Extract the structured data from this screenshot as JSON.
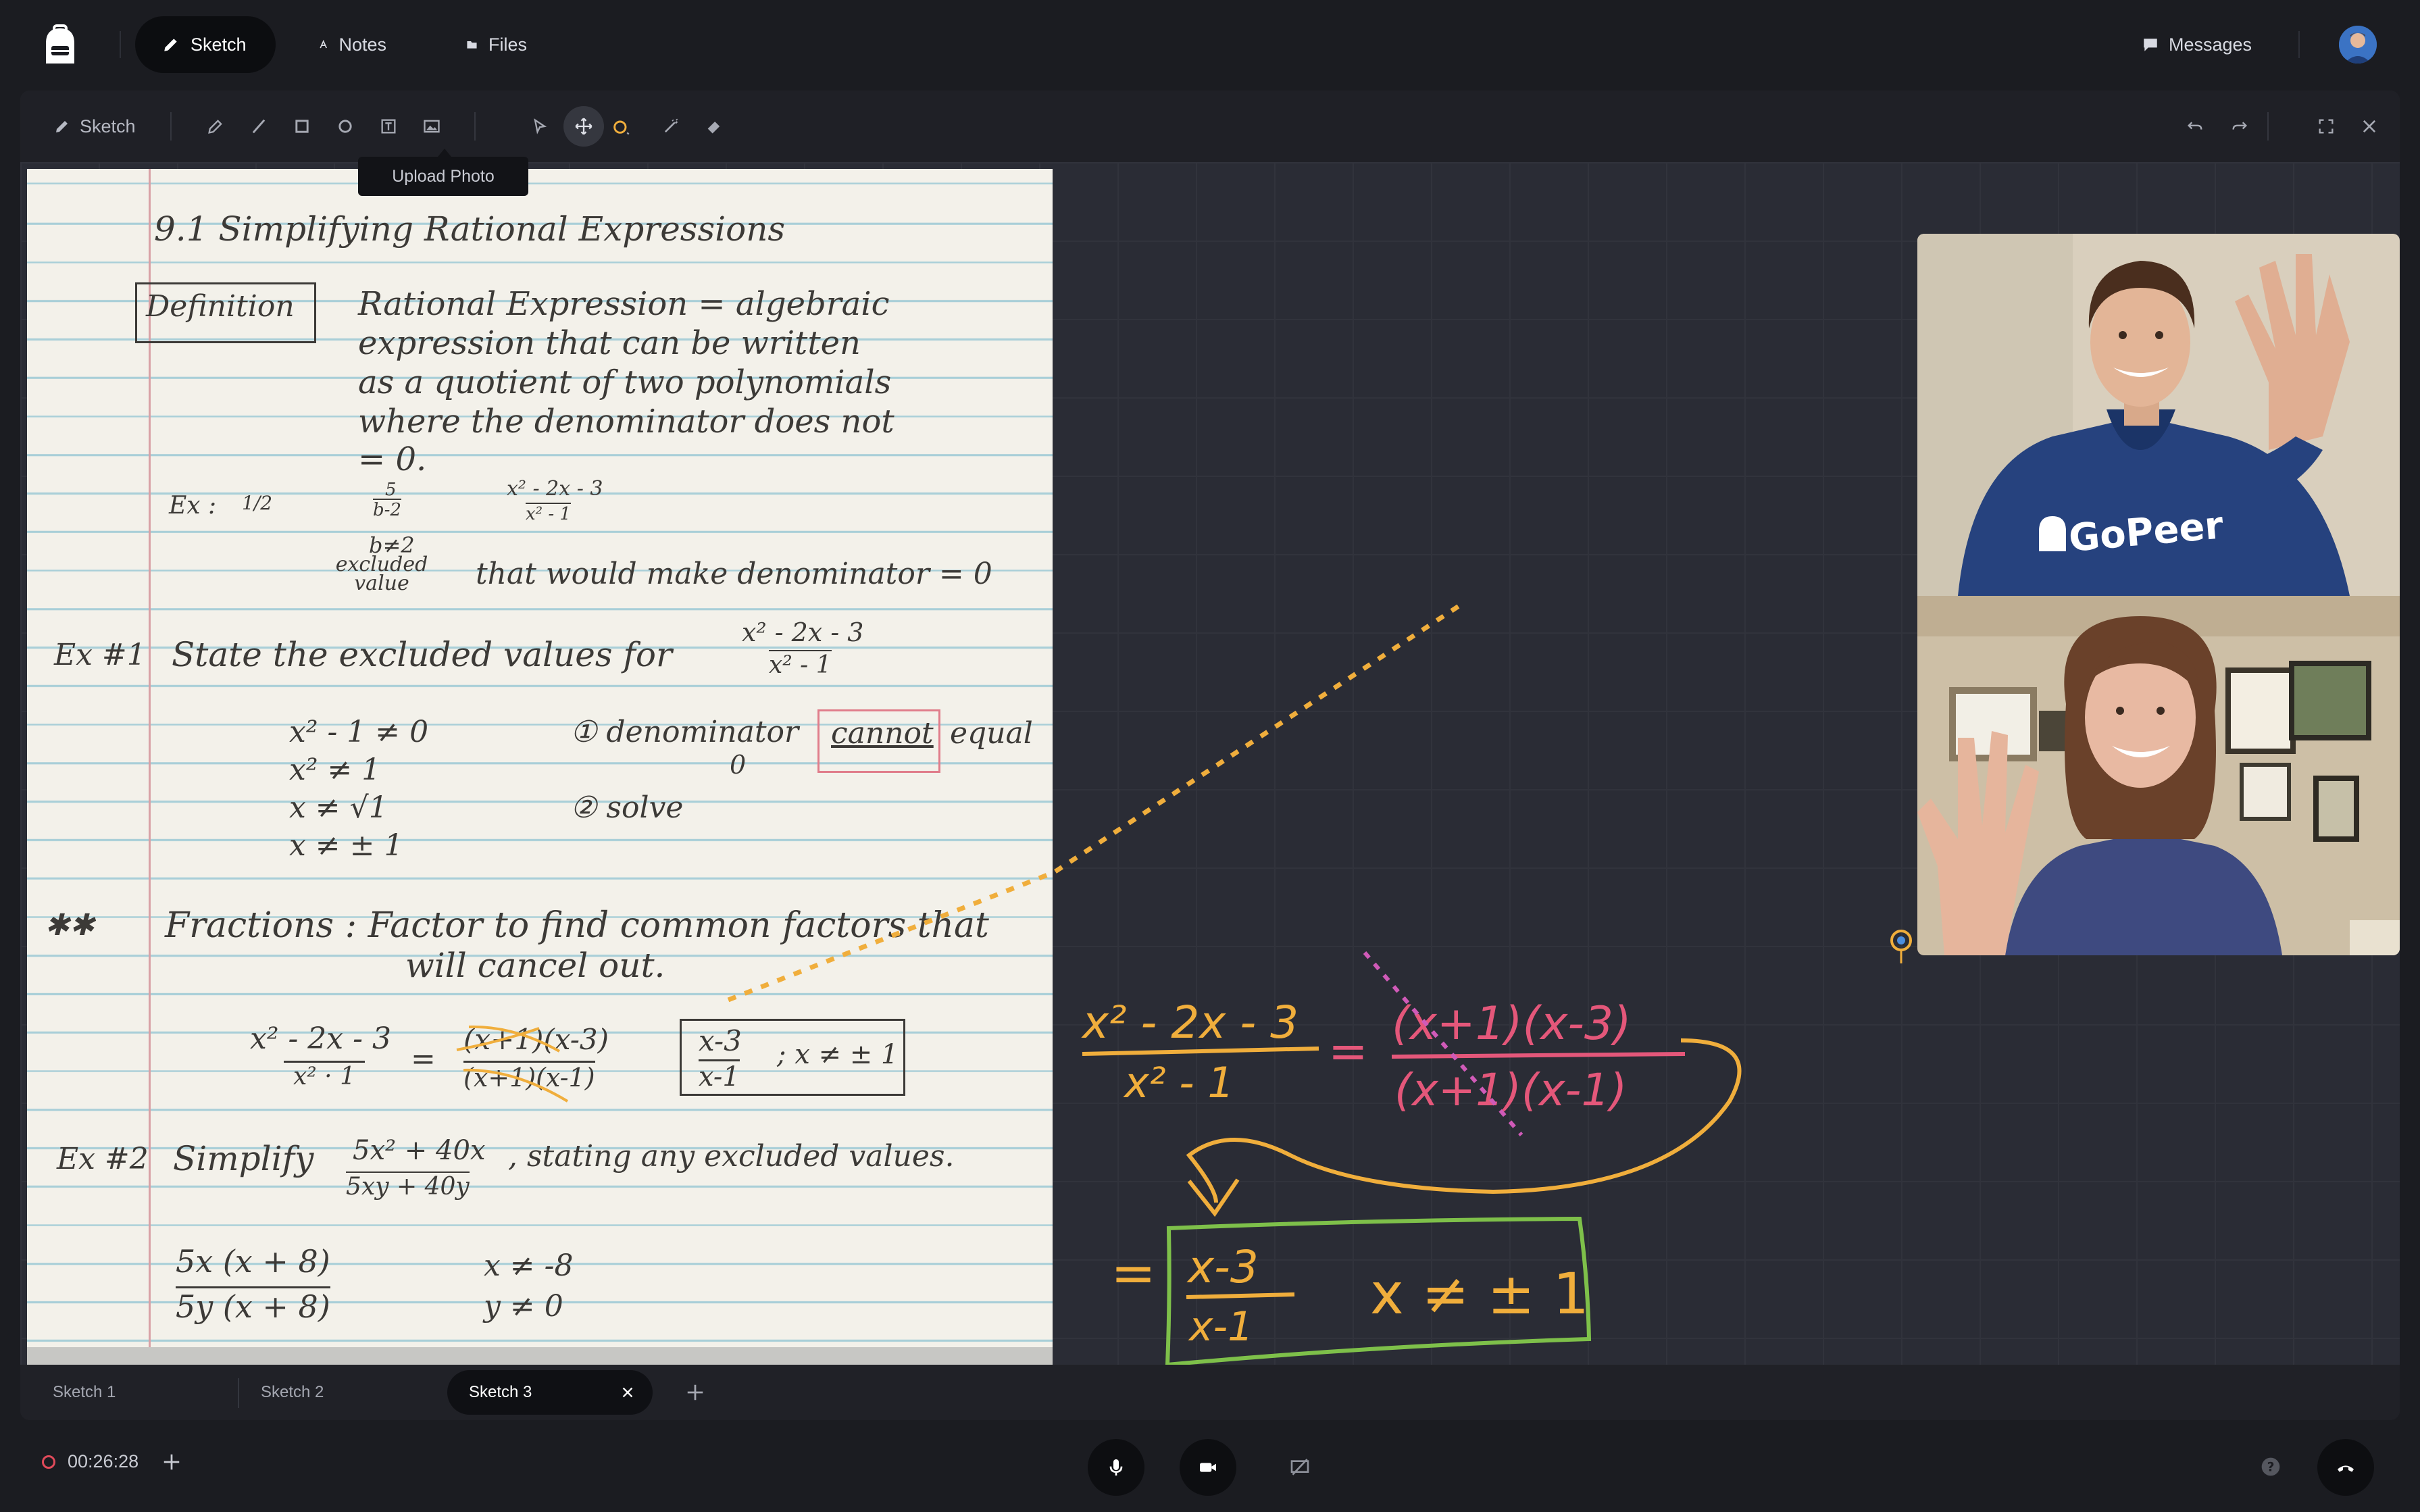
{
  "header": {
    "nav": [
      {
        "label": "Sketch",
        "icon": "pencil-icon",
        "active": true
      },
      {
        "label": "Notes",
        "icon": "notes-icon",
        "active": false
      },
      {
        "label": "Files",
        "icon": "folder-icon",
        "active": false
      }
    ],
    "messages_label": "Messages"
  },
  "toolbar": {
    "sketch_label": "Sketch",
    "tools": [
      "pen-icon",
      "line-icon",
      "rectangle-icon",
      "circle-icon",
      "text-icon",
      "image-icon",
      "select-icon",
      "move-icon",
      "color-icon",
      "wand-icon",
      "eraser-icon"
    ],
    "active_tool": "move-icon",
    "tooltip": "Upload Photo",
    "right": [
      "undo-icon",
      "redo-icon",
      "fullscreen-icon",
      "close-icon"
    ]
  },
  "notebook": {
    "title": "9.1 Simplifying Rational Expressions",
    "definition_label": "Definition",
    "definition_lines": [
      "Rational Expression = algebraic",
      "expression that can be written",
      "as a quotient of two polynomials",
      "where the denominator does not",
      "= 0."
    ],
    "ex_label": "Ex :",
    "ex_frac1": "1/2",
    "ex_frac2_num": "5",
    "ex_frac2_den": "b-2",
    "ex_frac3_num": "x² - 2x - 3",
    "ex_frac3_den": "x² - 1",
    "b_ne_2": "b≠2",
    "excluded_value": "excluded value",
    "that_note": "that would make denominator = 0",
    "ex1_label": "Ex #1",
    "ex1_text": "State the excluded values for",
    "ex1_num": "x² - 2x - 3",
    "ex1_den": "x² - 1",
    "steps_left": [
      "x² - 1 ≠ 0",
      "x² ≠ 1",
      "x ≠ √1",
      "x ≠ ± 1"
    ],
    "step1": "① denominator",
    "step1_cannot": "cannot",
    "step1_equal": "equal",
    "step1_zero": "0",
    "step2": "② solve",
    "stars": "✱✱",
    "fractions_line1": "Fractions : Factor to find common factors that",
    "fractions_line2": "will cancel out.",
    "eq_left_num": "x² - 2x - 3",
    "eq_left_den": "x² · 1",
    "eq_mid_num": "(x+1)(x-3)",
    "eq_mid_den": "(x+1)(x-1)",
    "eq_right_num": "x-3",
    "eq_right_den": "x-1",
    "eq_right_cond": "; x ≠ ± 1",
    "ex2_label": "Ex #2",
    "ex2_text": "Simplify",
    "ex2_num": "5x² + 40x",
    "ex2_den": "5xy + 40y",
    "ex2_tail": ", stating any excluded values.",
    "ex2_work_num": "5x (x + 8)",
    "ex2_work_den": "5y (x + 8)",
    "ex2_x": "x ≠ -8",
    "ex2_y": "y ≠ 0"
  },
  "videos": [
    {
      "name": "tutor-video",
      "shirt_text": "GoPeer"
    },
    {
      "name": "student-video"
    }
  ],
  "ink": {
    "colors": {
      "orange": "#f0ae3c",
      "pink": "#e4577a",
      "green": "#7ec04a",
      "magenta": "#d05ab8"
    },
    "lhs_num": "x² - 2x - 3",
    "lhs_den": "x² - 1",
    "rhs_num": "(x+1)(x-3)",
    "rhs_den": "(x+1)(x-1)",
    "res_num": "x-3",
    "res_den": "x-1",
    "res_cond": "x ≠ ± 1",
    "equals": "="
  },
  "sketch_tabs": [
    {
      "label": "Sketch 1",
      "active": false
    },
    {
      "label": "Sketch 2",
      "active": false
    },
    {
      "label": "Sketch 3",
      "active": true
    }
  ],
  "bottom": {
    "timer": "00:26:28"
  }
}
